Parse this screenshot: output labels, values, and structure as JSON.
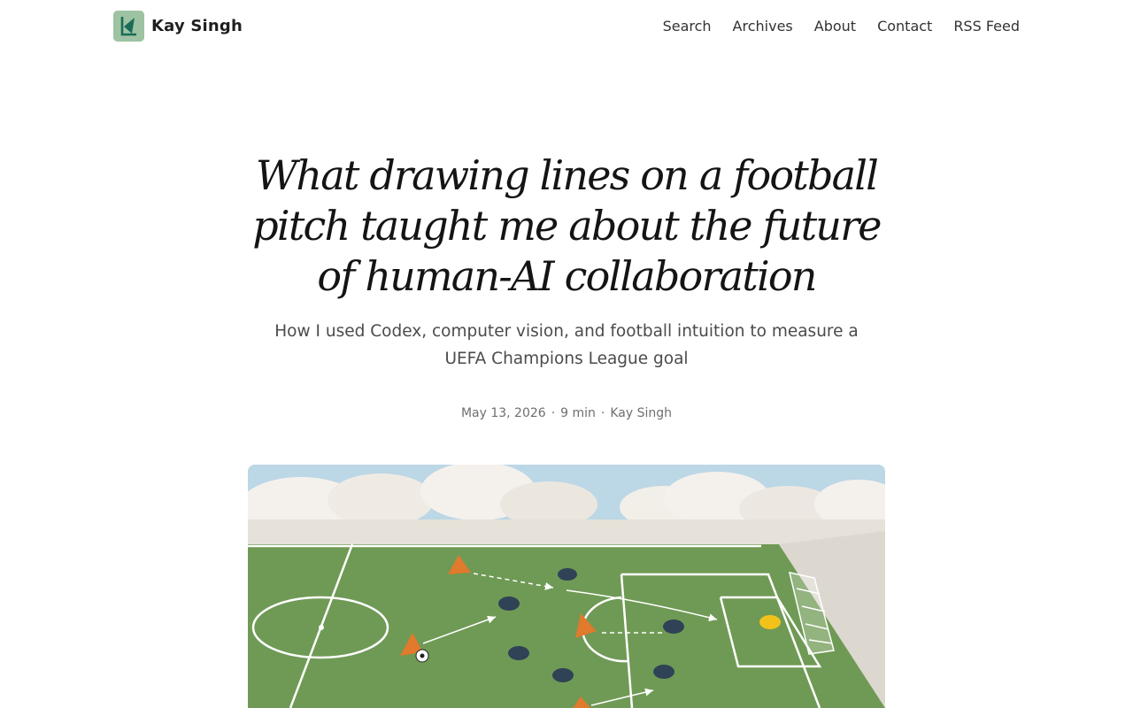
{
  "header": {
    "brand_name": "Kay Singh",
    "logo_letter": "K",
    "nav": [
      {
        "label": "Search"
      },
      {
        "label": "Archives"
      },
      {
        "label": "About"
      },
      {
        "label": "Contact"
      },
      {
        "label": "RSS Feed"
      }
    ]
  },
  "article": {
    "title": "What drawing lines on a football pitch taught me about the future of human-AI collaboration",
    "subtitle": "How I used Codex, computer vision, and football intuition to measure a UEFA Champions League goal",
    "date": "May 13, 2026",
    "read_time": "9 min",
    "author": "Kay Singh"
  },
  "colors": {
    "pitch": "#6f9a55",
    "sky": "#bcd7e6",
    "cones": "#e07a2c",
    "players": "#2f4256",
    "keeper": "#f2c21b",
    "logo_bg": "#9dc3a2",
    "logo_mark": "#1b6b57"
  }
}
